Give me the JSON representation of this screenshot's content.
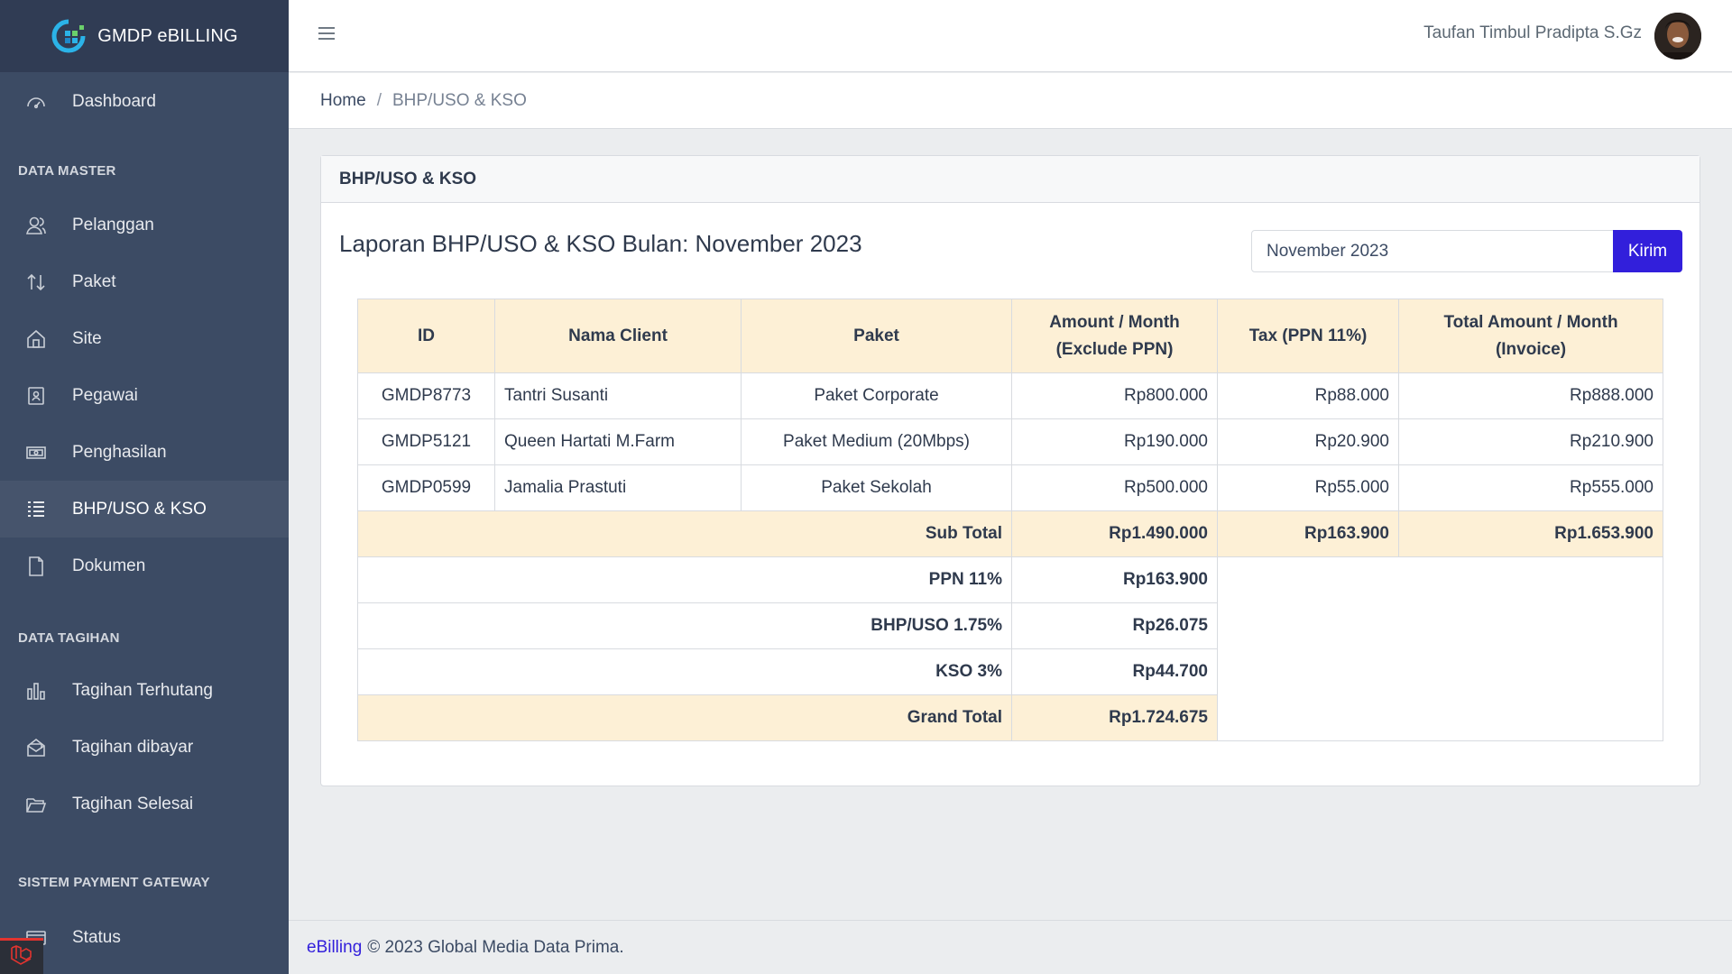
{
  "brand": {
    "name": "GMDP eBILLING"
  },
  "sidebar": {
    "dashboard": "Dashboard",
    "section_master": "DATA MASTER",
    "master_items": [
      {
        "label": "Pelanggan",
        "icon": "user-icon"
      },
      {
        "label": "Paket",
        "icon": "sort-arrows-icon"
      },
      {
        "label": "Site",
        "icon": "home-icon"
      },
      {
        "label": "Pegawai",
        "icon": "badge-icon"
      },
      {
        "label": "Penghasilan",
        "icon": "money-icon"
      },
      {
        "label": "BHP/USO & KSO",
        "icon": "list-icon",
        "active": true
      },
      {
        "label": "Dokumen",
        "icon": "document-icon"
      }
    ],
    "section_tagihan": "DATA TAGIHAN",
    "tagihan_items": [
      {
        "label": "Tagihan Terhutang",
        "icon": "bar-chart-icon"
      },
      {
        "label": "Tagihan dibayar",
        "icon": "inbox-icon"
      },
      {
        "label": "Tagihan Selesai",
        "icon": "folder-open-icon"
      }
    ],
    "section_payment": "SISTEM PAYMENT GATEWAY",
    "payment_items": [
      {
        "label": "Status",
        "icon": "card-icon"
      }
    ]
  },
  "header": {
    "user_name": "Taufan Timbul Pradipta S.Gz"
  },
  "breadcrumb": {
    "home": "Home",
    "separator": "/",
    "current": "BHP/USO & KSO"
  },
  "card": {
    "header": "BHP/USO & KSO",
    "report_title": "Laporan BHP/USO & KSO Bulan: November 2023",
    "month_value": "November 2023",
    "submit_label": "Kirim"
  },
  "table": {
    "headers": {
      "id": "ID",
      "name": "Nama Client",
      "paket": "Paket",
      "amount_line1": "Amount / Month",
      "amount_line2": "(Exclude PPN)",
      "tax": "Tax (PPN 11%)",
      "total_line1": "Total Amount / Month",
      "total_line2": "(Invoice)"
    },
    "rows": [
      {
        "id": "GMDP8773",
        "name": "Tantri Susanti",
        "paket": "Paket Corporate",
        "amount": "Rp800.000",
        "tax": "Rp88.000",
        "total": "Rp888.000"
      },
      {
        "id": "GMDP5121",
        "name": "Queen Hartati M.Farm",
        "paket": "Paket Medium (20Mbps)",
        "amount": "Rp190.000",
        "tax": "Rp20.900",
        "total": "Rp210.900"
      },
      {
        "id": "GMDP0599",
        "name": "Jamalia Prastuti",
        "paket": "Paket Sekolah",
        "amount": "Rp500.000",
        "tax": "Rp55.000",
        "total": "Rp555.000"
      }
    ],
    "subtotal": {
      "label": "Sub Total",
      "amount": "Rp1.490.000",
      "tax": "Rp163.900",
      "total": "Rp1.653.900"
    },
    "ppn": {
      "label": "PPN 11%",
      "value": "Rp163.900"
    },
    "bhp": {
      "label": "BHP/USO 1.75%",
      "value": "Rp26.075"
    },
    "kso": {
      "label": "KSO 3%",
      "value": "Rp44.700"
    },
    "grand_total": {
      "label": "Grand Total",
      "value": "Rp1.724.675"
    }
  },
  "footer": {
    "link": "eBilling",
    "text": "© 2023 Global Media Data Prima."
  },
  "colors": {
    "sidebar": "#3c4b64",
    "primary": "#321fdb",
    "highlight": "#fdf0d6"
  }
}
